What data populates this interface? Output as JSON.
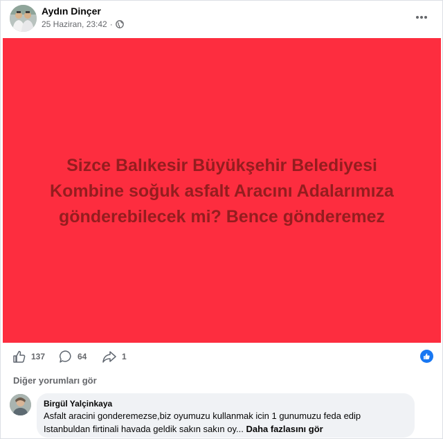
{
  "post": {
    "author": "Aydın Dinçer",
    "timestamp": "25 Haziran, 23:42",
    "separator": "·",
    "privacy_icon": "globe-icon",
    "menu_icon": "more-options-icon",
    "banner": {
      "background": "#fd2d3f",
      "text_color": "#941d1f",
      "line1": "Sizce Balıkesir Büyükşehir Belediyesi",
      "line2": "Kombine soğuk asfalt Aracını Adalarımıza",
      "line3": "gönderebilecek mi? Bence gönderemez"
    }
  },
  "reactions": {
    "likes": "137",
    "comments": "64",
    "shares": "1",
    "accent": "#1877f2"
  },
  "comments_section": {
    "view_more_label": "Diğer yorumları gör",
    "comment": {
      "name": "Birgül Yalçinkaya",
      "text_line1": "Asfalt aracini gonderemezse,biz oyumuzu kullanmak icin 1 gunumuzu feda edip",
      "text_line2": "Istanbuldan firtinali havada geldik sakın sakın oy...",
      "see_more": "Daha fazlasını gör"
    }
  }
}
